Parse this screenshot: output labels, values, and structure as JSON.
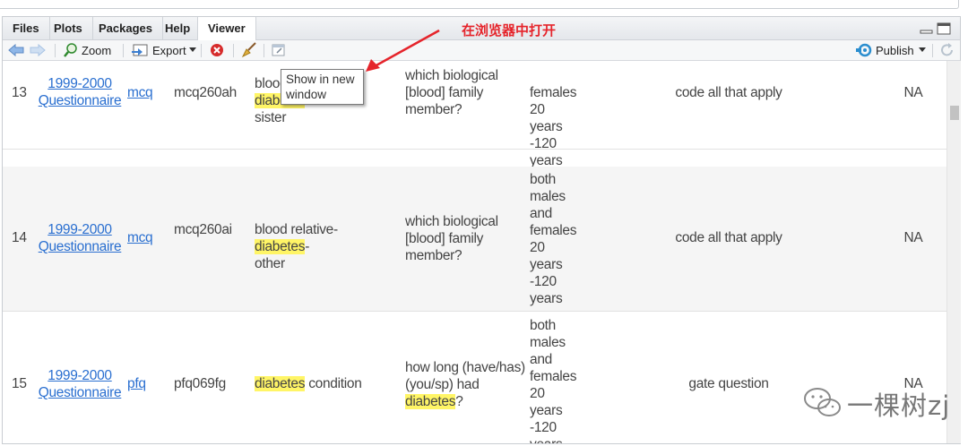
{
  "tabs": [
    "Files",
    "Plots",
    "Packages",
    "Help",
    "Viewer"
  ],
  "active_tab": "Viewer",
  "toolbar": {
    "zoom_label": "Zoom",
    "export_label": "Export",
    "publish_label": "Publish"
  },
  "annotation": "在浏览器中打开",
  "tooltip": "Show in new window",
  "watermark": "一棵树zj",
  "rows": [
    {
      "num": "13",
      "year": "1999-2000",
      "questionnaire": "Questionnaire",
      "file": "mcq",
      "variable": "mcq260ah",
      "desc_pre": "blood relative-",
      "desc_hl": "diabetes",
      "desc_post": "-",
      "desc_line2": "sister",
      "question_line1": "which biological",
      "question_line2": "[blood] family",
      "question_line3": "member?",
      "target": [
        "females",
        "20",
        "years",
        "-120",
        "years"
      ],
      "instructions": "code all that apply",
      "na": "NA"
    },
    {
      "num": "14",
      "year": "1999-2000",
      "questionnaire": "Questionnaire",
      "file": "mcq",
      "variable": "mcq260ai",
      "desc_pre": "blood relative-",
      "desc_hl": "diabetes",
      "desc_post": "-",
      "desc_line2": "other",
      "question_line1": "which biological",
      "question_line2": "[blood] family",
      "question_line3": "member?",
      "target": [
        "both",
        "males",
        "and",
        "females",
        "20",
        "years",
        "-120",
        "years"
      ],
      "instructions": "code all that apply",
      "na": "NA"
    },
    {
      "num": "15",
      "year": "1999-2000",
      "questionnaire": "Questionnaire",
      "file": "pfq",
      "variable": "pfq069fg",
      "desc_hl": "diabetes",
      "desc_post": " condition",
      "question_line1": "how long (have/has)",
      "question_line2": "(you/sp) had",
      "question_hl": "diabetes",
      "question_post": "?",
      "target": [
        "both",
        "males",
        "and",
        "females",
        "20",
        "years",
        "-120",
        "years"
      ],
      "instructions": "gate question",
      "na": "NA"
    }
  ]
}
